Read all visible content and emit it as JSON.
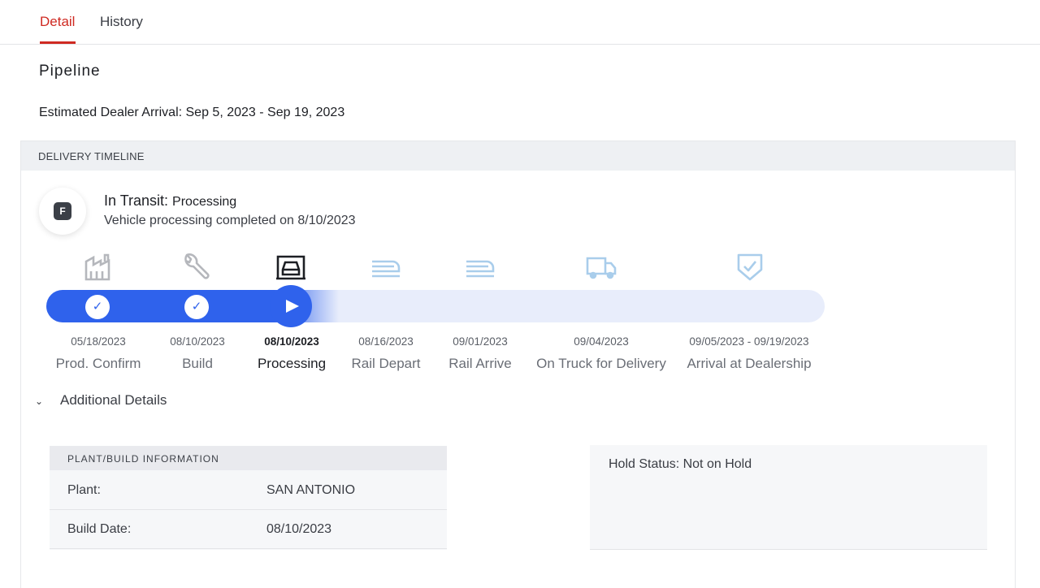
{
  "tabs": [
    {
      "label": "Detail",
      "active": true
    },
    {
      "label": "History",
      "active": false
    }
  ],
  "pipeline": {
    "title": "Pipeline",
    "eta": "Estimated Dealer Arrival: Sep 5, 2023 - Sep 19, 2023"
  },
  "timeline": {
    "header": "DELIVERY TIMELINE",
    "status_icon_letter": "F",
    "status_title": "In Transit:",
    "status_sub": "Processing",
    "status_detail": "Vehicle processing completed on 8/10/2023",
    "stages": [
      {
        "label": "Prod. Confirm",
        "date": "05/18/2023",
        "icon": "factory-icon",
        "state": "complete"
      },
      {
        "label": "Build",
        "date": "08/10/2023",
        "icon": "wrench-icon",
        "state": "complete"
      },
      {
        "label": "Processing",
        "date": "08/10/2023",
        "icon": "vehicle-processing-icon",
        "state": "current"
      },
      {
        "label": "Rail Depart",
        "date": "08/16/2023",
        "icon": "train-icon",
        "state": "upcoming"
      },
      {
        "label": "Rail Arrive",
        "date": "09/01/2023",
        "icon": "train-icon",
        "state": "upcoming"
      },
      {
        "label": "On Truck for Delivery",
        "date": "09/04/2023",
        "icon": "truck-icon",
        "state": "upcoming"
      },
      {
        "label": "Arrival at Dealership",
        "date": "09/05/2023 - 09/19/2023",
        "icon": "shield-check-icon",
        "state": "upcoming"
      }
    ],
    "progress_fraction": 0.34
  },
  "additional_details": {
    "label": "Additional Details",
    "plant_info": {
      "header": "PLANT/BUILD INFORMATION",
      "rows": [
        {
          "key": "Plant:",
          "value": "SAN ANTONIO"
        },
        {
          "key": "Build Date:",
          "value": "08/10/2023"
        }
      ]
    },
    "hold_status": "Hold Status: Not on Hold"
  },
  "colors": {
    "accent_red": "#cf2a22",
    "progress_blue": "#2f62ec",
    "track_bg": "#e8edfb",
    "upcoming_icon": "#a9cdeb",
    "complete_icon": "#b5b7bc"
  }
}
